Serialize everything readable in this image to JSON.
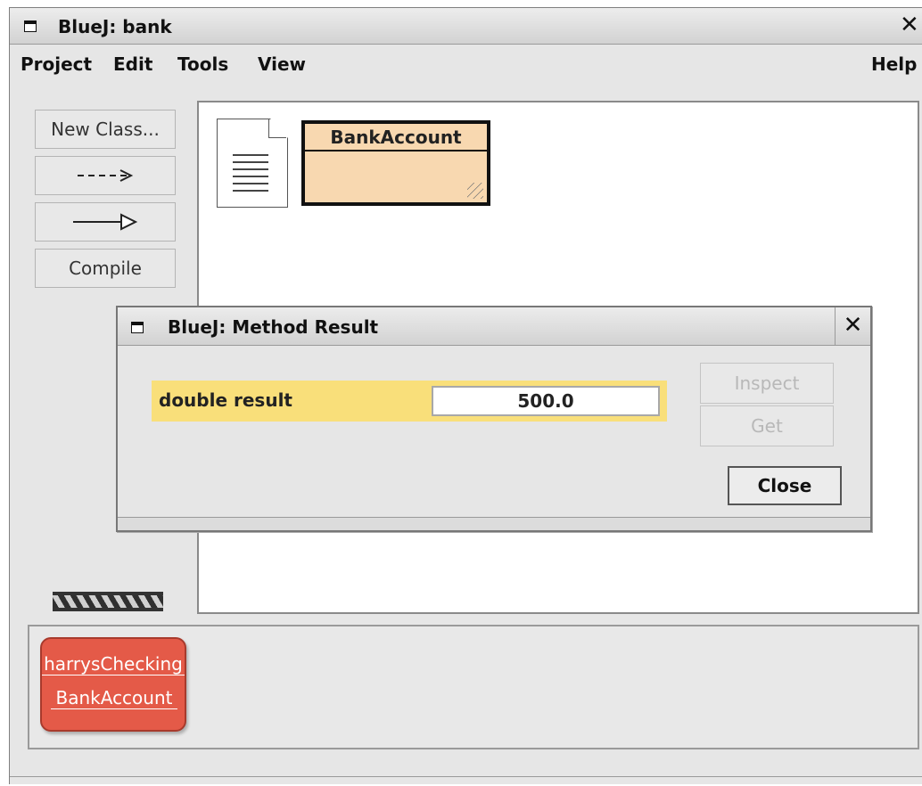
{
  "window": {
    "title": "BlueJ:  bank",
    "close_glyph": "✕"
  },
  "menu": {
    "items": [
      "Project",
      "Edit",
      "Tools",
      "View"
    ],
    "help": "Help"
  },
  "toolbar": {
    "new_class": "New Class...",
    "dependency_arrow": "--->",
    "inheritance_arrow": "—▷",
    "compile": "Compile"
  },
  "canvas": {
    "class_name": "BankAccount"
  },
  "bench": {
    "object_name": "harrysChecking",
    "object_type": "BankAccount"
  },
  "dialog": {
    "title": "BlueJ:  Method Result",
    "close_glyph": "✕",
    "result_label": "double result",
    "result_value": "500.0",
    "inspect_label": "Inspect",
    "get_label": "Get",
    "close_label": "Close"
  },
  "colors": {
    "class_fill": "#f8d8b0",
    "object_fill": "#e45a48",
    "result_highlight": "#f9df7a"
  }
}
